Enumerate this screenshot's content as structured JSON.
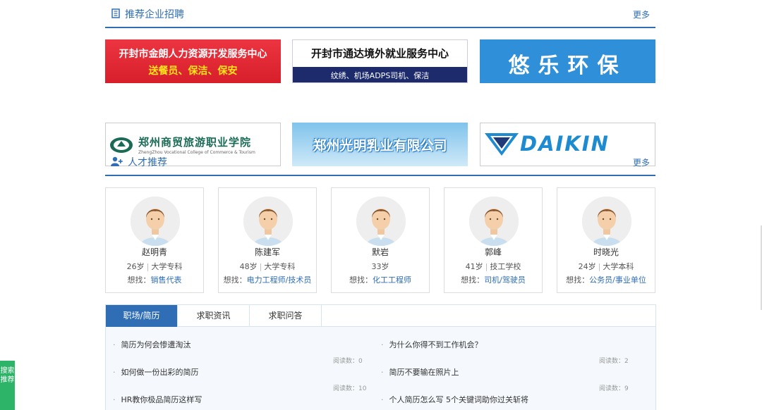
{
  "enterprise_section": {
    "title": "推荐企业招聘",
    "more": "更多",
    "ads": [
      {
        "line1": "开封市金朗人力资源开发服务中心",
        "line2": "送餐员、保洁、保安"
      },
      {
        "line1": "开封市通达境外就业服务中心",
        "line2": "纹绣、机场ADPS司机、保洁"
      },
      {
        "line1": "悠乐环保"
      },
      {
        "line1": "郑州商贸旅游职业学院",
        "line2": "ZhengZhou Vocational College of Commerce & Tourism"
      },
      {
        "line1": "郑州光明乳业有限公司"
      },
      {
        "line1": "DAIKIN"
      }
    ]
  },
  "talent_section": {
    "title": "人才推荐",
    "more": "更多",
    "want_label": "想找：",
    "people": [
      {
        "name": "赵明青",
        "age": "26岁",
        "edu": "大学专科",
        "job": "销售代表"
      },
      {
        "name": "陈建军",
        "age": "48岁",
        "edu": "大学专科",
        "job": "电力工程师/技术员"
      },
      {
        "name": "默岩",
        "age": "33岁",
        "edu": "",
        "job": "化工工程师"
      },
      {
        "name": "郭峰",
        "age": "41岁",
        "edu": "技工学校",
        "job": "司机/驾驶员"
      },
      {
        "name": "时晓光",
        "age": "24岁",
        "edu": "大学本科",
        "job": "公务员/事业单位"
      }
    ]
  },
  "tabs": {
    "items": [
      "职场/简历",
      "求职资讯",
      "求职问答"
    ],
    "active": 0
  },
  "articles": {
    "left": [
      {
        "title": "简历为何会惨遭淘汰",
        "reads": "阅读数：0"
      },
      {
        "title": "如何做一份出彩的简历",
        "reads": "阅读数：10"
      },
      {
        "title": "HR教你极品简历这样写"
      }
    ],
    "right": [
      {
        "title": "为什么你得不到工作机会？",
        "reads": "阅读数：2"
      },
      {
        "title": "简历不要输在照片上",
        "reads": "阅读数：9"
      },
      {
        "title": "个人简历怎么写 5个关键词助你过关斩将"
      }
    ]
  },
  "side_tab": {
    "label": "搜索推荐"
  },
  "colors": {
    "accent": "#2f6eb5",
    "side_tab": "#2db469",
    "active_tab": "#2f6eb5"
  }
}
